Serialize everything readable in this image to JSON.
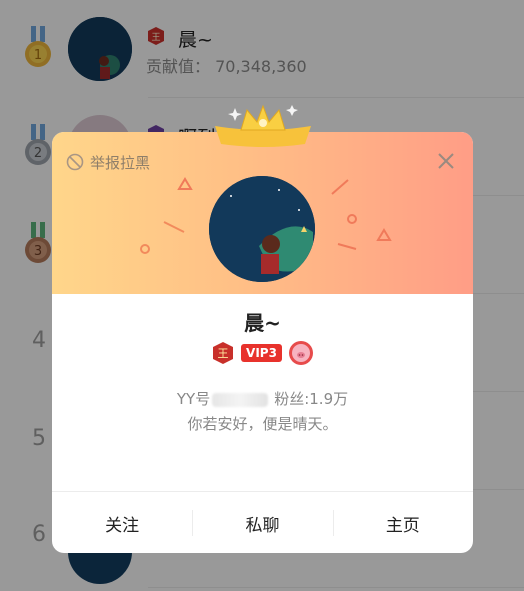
{
  "list": {
    "rows": [
      {
        "rank": "1",
        "name": "晨~",
        "contrib_label": "贡献值：",
        "contrib_value": "70,348,360"
      },
      {
        "rank": "2",
        "name": "啊烈",
        "contrib_label": "",
        "contrib_value": ""
      },
      {
        "rank": "3",
        "name": "",
        "contrib_label": "",
        "contrib_value": ""
      },
      {
        "rank": "4",
        "name": "",
        "contrib_label": "",
        "contrib_value": ""
      },
      {
        "rank": "5",
        "name": "",
        "contrib_label": "",
        "contrib_value": ""
      },
      {
        "rank": "6",
        "name": "",
        "contrib_label": "",
        "contrib_value": ""
      }
    ]
  },
  "card": {
    "report_label": "举报拉黑",
    "name": "晨~",
    "badge_king": "王",
    "badge_vip": "VIP3",
    "yy_label": "YY号",
    "fans": "粉丝:1.9万",
    "signature": "你若安好，便是晴天。",
    "actions": {
      "follow": "关注",
      "chat": "私聊",
      "home": "主页"
    }
  },
  "colors": {
    "header_left": "#ffd68a",
    "header_right": "#ff9d86",
    "vip_red": "#e8322c",
    "gold": "#f7c23b"
  },
  "icons": {
    "report": "block-icon",
    "close": "close-icon",
    "crown": "crown-icon",
    "medal": "medal-icon"
  }
}
